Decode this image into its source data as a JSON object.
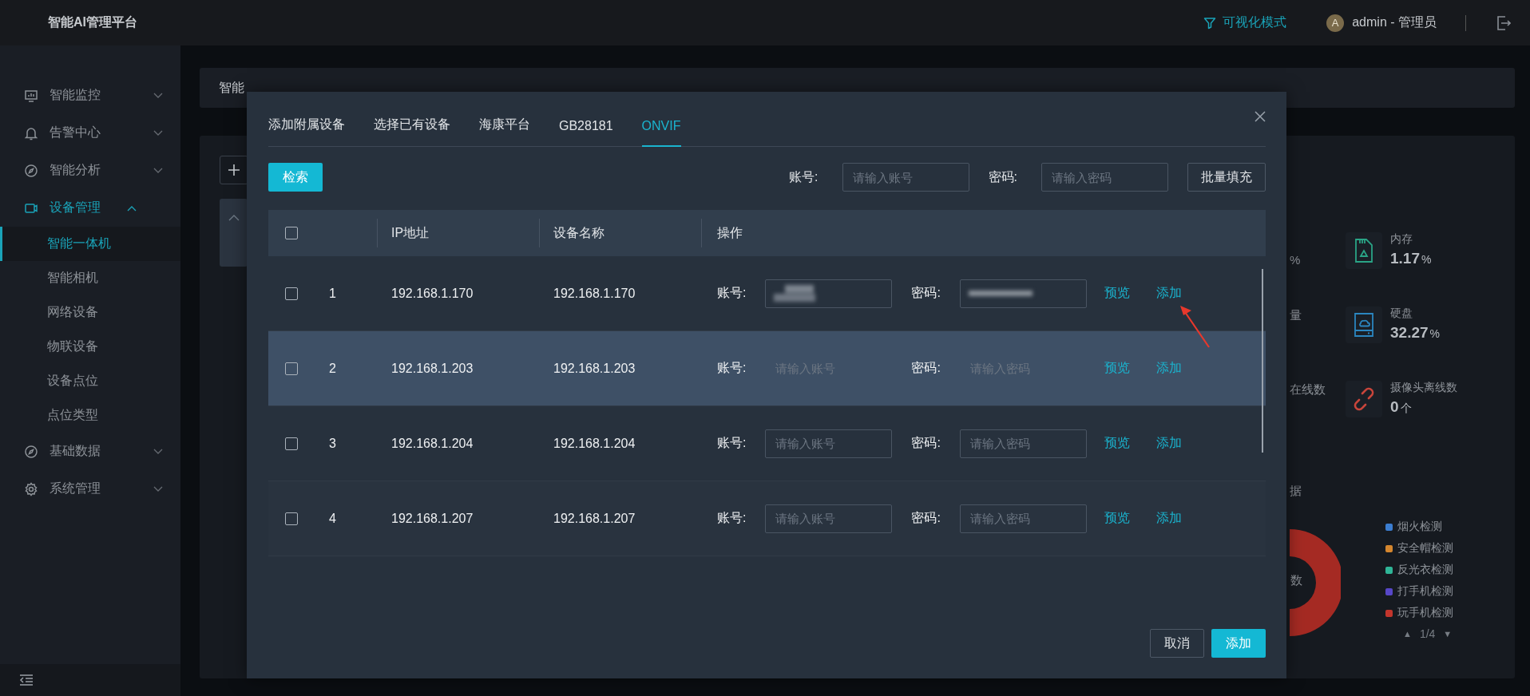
{
  "app": {
    "title": "智能AI管理平台"
  },
  "header": {
    "mode_link": "可视化模式",
    "avatar_letter": "A",
    "user": "admin - 管理员"
  },
  "sidebar": {
    "items": [
      {
        "label": "智能监控",
        "expanded": false
      },
      {
        "label": "告警中心",
        "expanded": false
      },
      {
        "label": "智能分析",
        "expanded": false
      },
      {
        "label": "设备管理",
        "expanded": true,
        "children": [
          {
            "label": "智能一体机",
            "selected": true
          },
          {
            "label": "智能相机",
            "selected": false
          },
          {
            "label": "网络设备",
            "selected": false
          },
          {
            "label": "物联设备",
            "selected": false
          },
          {
            "label": "设备点位",
            "selected": false
          },
          {
            "label": "点位类型",
            "selected": false
          }
        ]
      },
      {
        "label": "基础数据",
        "expanded": false
      },
      {
        "label": "系统管理",
        "expanded": false
      }
    ]
  },
  "breadcrumb": "智能",
  "dashboard": {
    "stats": [
      {
        "fragment": "%",
        "label": "内存",
        "value": "1.17",
        "unit": "%"
      },
      {
        "fragment": "量",
        "label": "硬盘",
        "value": "32.27",
        "unit": "%"
      },
      {
        "fragment": "在线数",
        "label": "摄像头离线数",
        "value": "0",
        "unit": "个"
      }
    ],
    "chart_fragment": "据",
    "donut_fragment": "数",
    "legend": [
      {
        "label": "烟火检测",
        "color": "#3b7dd0"
      },
      {
        "label": "安全帽检测",
        "color": "#d4862e"
      },
      {
        "label": "反光衣检测",
        "color": "#2fb597"
      },
      {
        "label": "打手机检测",
        "color": "#5747c8"
      },
      {
        "label": "玩手机检测",
        "color": "#c2352c"
      }
    ],
    "pager": {
      "prev": "▲",
      "page": "1/4",
      "next": "▼"
    }
  },
  "dialog": {
    "tabs": [
      {
        "label": "添加附属设备",
        "selected": false
      },
      {
        "label": "选择已有设备",
        "selected": false
      },
      {
        "label": "海康平台",
        "selected": false
      },
      {
        "label": "GB28181",
        "selected": false
      },
      {
        "label": "ONVIF",
        "selected": true
      }
    ],
    "search_button": "检索",
    "account": {
      "label": "账号:",
      "placeholder": "请输入账号"
    },
    "password": {
      "label": "密码:",
      "placeholder": "请输入密码"
    },
    "batch_button": "批量填充",
    "table": {
      "header_checked": false,
      "columns": [
        {
          "label": "IP地址"
        },
        {
          "label": "设备名称"
        },
        {
          "label": "操作"
        }
      ],
      "rows": [
        {
          "index": "1",
          "ip": "192.168.1.170",
          "name": "192.168.1.170",
          "checked": false,
          "selected": false,
          "account": {
            "label": "账号:",
            "masked": true
          },
          "password": {
            "label": "密码:",
            "masked": true
          },
          "actions": [
            "预览",
            "添加"
          ]
        },
        {
          "index": "2",
          "ip": "192.168.1.203",
          "name": "192.168.1.203",
          "checked": false,
          "selected": true,
          "account": {
            "label": "账号:",
            "placeholder": "请输入账号"
          },
          "password": {
            "label": "密码:",
            "placeholder": "请输入密码"
          },
          "actions": [
            "预览",
            "添加"
          ]
        },
        {
          "index": "3",
          "ip": "192.168.1.204",
          "name": "192.168.1.204",
          "checked": false,
          "selected": false,
          "account": {
            "label": "账号:",
            "placeholder": "请输入账号"
          },
          "password": {
            "label": "密码:",
            "placeholder": "请输入密码"
          },
          "actions": [
            "预览",
            "添加"
          ]
        },
        {
          "index": "4",
          "ip": "192.168.1.207",
          "name": "192.168.1.207",
          "checked": false,
          "selected": false,
          "account": {
            "label": "账号:",
            "placeholder": "请输入账号"
          },
          "password": {
            "label": "密码:",
            "placeholder": "请输入密码"
          },
          "actions": [
            "预览",
            "添加"
          ]
        }
      ]
    },
    "footer": [
      {
        "label": "取消",
        "kind": "default"
      },
      {
        "label": "添加",
        "kind": "primary"
      }
    ]
  }
}
